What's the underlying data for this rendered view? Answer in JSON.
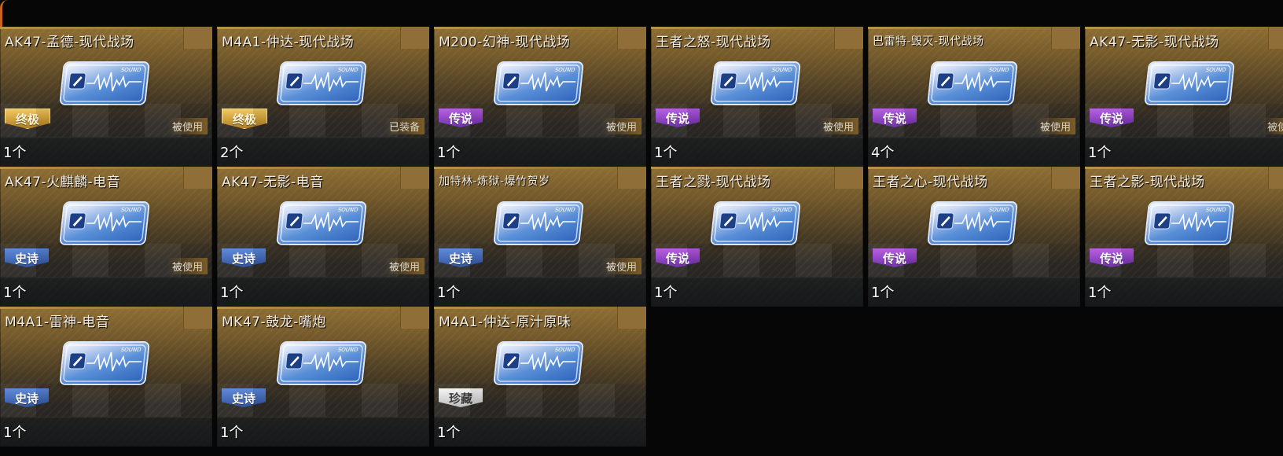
{
  "items": [
    {
      "title": "AK47-孟德-现代战场",
      "rarity": "终极",
      "rarity_type": "ultimate",
      "status": "被使用",
      "count": "1个"
    },
    {
      "title": "M4A1-仲达-现代战场",
      "rarity": "终极",
      "rarity_type": "ultimate",
      "status": "已装备",
      "count": "2个"
    },
    {
      "title": "M200-幻神-现代战场",
      "rarity": "传说",
      "rarity_type": "legend",
      "status": "被使用",
      "count": "1个"
    },
    {
      "title": "王者之怒-现代战场",
      "rarity": "传说",
      "rarity_type": "legend",
      "status": "被使用",
      "count": "1个"
    },
    {
      "title": "巴雷特-毁灭-现代战场",
      "rarity": "传说",
      "rarity_type": "legend",
      "status": "被使用",
      "count": "4个",
      "small": true
    },
    {
      "title": "AK47-无影-现代战场",
      "rarity": "传说",
      "rarity_type": "legend",
      "status": "被使",
      "count": "1个"
    },
    {
      "title": "AK47-火麒麟-电音",
      "rarity": "史诗",
      "rarity_type": "epic",
      "status": "被使用",
      "count": "1个"
    },
    {
      "title": "AK47-无影-电音",
      "rarity": "史诗",
      "rarity_type": "epic",
      "status": "被使用",
      "count": "1个"
    },
    {
      "title": "加特林-炼狱-爆竹贺岁",
      "rarity": "史诗",
      "rarity_type": "epic",
      "status": "被使用",
      "count": "1个",
      "small": true
    },
    {
      "title": "王者之戮-现代战场",
      "rarity": "传说",
      "rarity_type": "legend",
      "status": "",
      "count": "1个"
    },
    {
      "title": "王者之心-现代战场",
      "rarity": "传说",
      "rarity_type": "legend",
      "status": "",
      "count": "1个"
    },
    {
      "title": "王者之影-现代战场",
      "rarity": "传说",
      "rarity_type": "legend",
      "status": "",
      "count": "1个"
    },
    {
      "title": "M4A1-雷神-电音",
      "rarity": "史诗",
      "rarity_type": "epic",
      "status": "",
      "count": "1个"
    },
    {
      "title": "MK47-鼓龙-嘴炮",
      "rarity": "史诗",
      "rarity_type": "epic",
      "status": "",
      "count": "1个"
    },
    {
      "title": "M4A1-仲达-原汁原味",
      "rarity": "珍藏",
      "rarity_type": "treasure",
      "status": "",
      "count": "1个"
    }
  ],
  "sound_label": "SOUND",
  "colors": {
    "ultimate": "#d9a43a",
    "legend": "#8e3fc8",
    "epic": "#3d66c0",
    "treasure": "#dcdcdc"
  }
}
